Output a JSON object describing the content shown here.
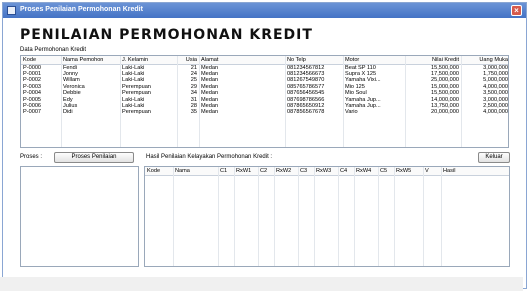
{
  "window": {
    "title": "Proses Penilaian Permohonan Kredit",
    "close_label": "×"
  },
  "heading": "PENILAIAN PERMOHONAN KREDIT",
  "data_label": "Data Permohonan Kredit",
  "top_table": {
    "columns": [
      "Kode",
      "Nama Pemohon",
      "J. Kelamin",
      "Usia",
      "Alamat",
      "No Telp",
      "Motor",
      "Nilai Kredit",
      "Uang Muka"
    ],
    "rows": [
      [
        "P-0000",
        "Fendi",
        "Laki-Laki",
        "21",
        "Medan",
        "081234567812",
        "Beat SP 110",
        "15,500,000",
        "3,000,000"
      ],
      [
        "P-0001",
        "Jonny",
        "Laki-Laki",
        "24",
        "Medan",
        "081234566673",
        "Supra X 125",
        "17,500,000",
        "1,750,000"
      ],
      [
        "P-0002",
        "Willam",
        "Laki-Laki",
        "25",
        "Medan",
        "081267549870",
        "Yamaha Vixi...",
        "25,000,000",
        "5,000,000"
      ],
      [
        "P-0003",
        "Veronica",
        "Perempuan",
        "29",
        "Medan",
        "085765786577",
        "Mio 125",
        "15,000,000",
        "4,000,000"
      ],
      [
        "P-0004",
        "Debbie",
        "Perempuan",
        "34",
        "Medan",
        "087656456545",
        "Mio Soul",
        "15,500,000",
        "3,500,000"
      ],
      [
        "P-0005",
        "Edy",
        "Laki-Laki",
        "31",
        "Medan",
        "087698786566",
        "Yamaha Jup...",
        "14,000,000",
        "3,000,000"
      ],
      [
        "P-0006",
        "Julius",
        "Laki-Laki",
        "28",
        "Medan",
        "087865650912",
        "Yamaha Jup...",
        "13,750,000",
        "2,500,000"
      ],
      [
        "P-0007",
        "Didi",
        "Perempuan",
        "35",
        "Medan",
        "087856567678",
        "Vario",
        "20,000,000",
        "4,000,000"
      ]
    ]
  },
  "proses_label": "Proses :",
  "proses_button": "Proses Penilaian",
  "hasil_label": "Hasil Penilaian Kelayakan Permohonan Kredit :",
  "keluar_button": "Keluar",
  "result_table": {
    "columns": [
      "Kode",
      "Nama",
      "C1",
      "RxW1",
      "C2",
      "RxW2",
      "C3",
      "RxW3",
      "C4",
      "RxW4",
      "C5",
      "RxW5",
      "V",
      "Hasil"
    ],
    "rows": []
  }
}
